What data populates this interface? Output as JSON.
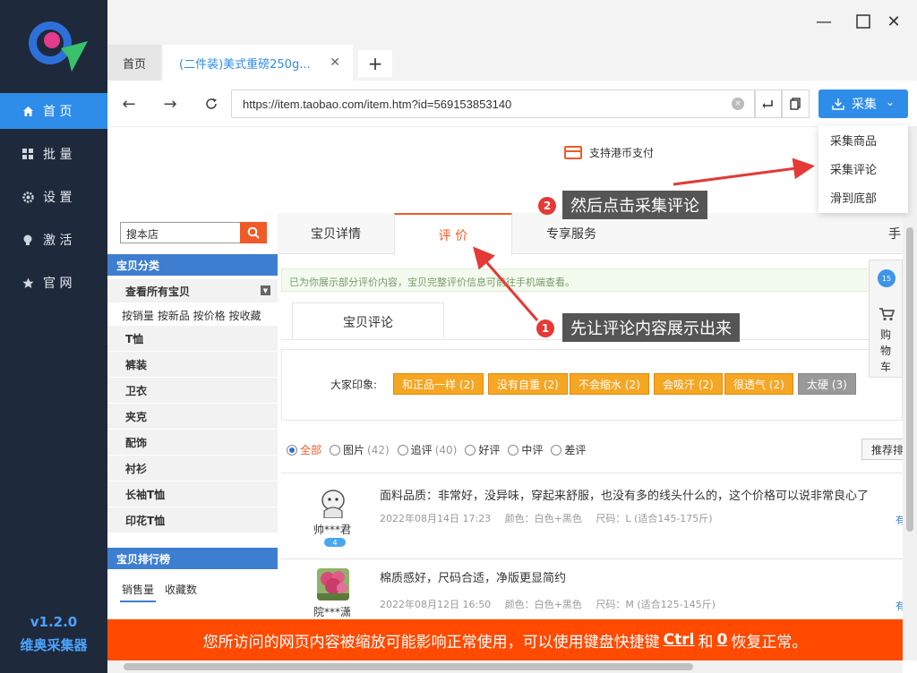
{
  "sidebar": {
    "items": [
      {
        "label": "首 页",
        "icon": "home-icon",
        "active": true
      },
      {
        "label": "批 量",
        "icon": "grid-icon"
      },
      {
        "label": "设 置",
        "icon": "gear-icon"
      },
      {
        "label": "激 活",
        "icon": "bulb-icon"
      },
      {
        "label": "官 网",
        "icon": "star-icon"
      }
    ],
    "version": "v1.2.0",
    "app_name": "维奥采集器"
  },
  "window": {
    "minimize": "—",
    "maximize": "☐",
    "close": "✕"
  },
  "tabs": {
    "home": "首页",
    "active_title": "(二件装)美式重磅250g...",
    "close": "✕",
    "add": "+"
  },
  "addressbar": {
    "back": "←",
    "forward": "→",
    "reload": "C",
    "url": "https://item.taobao.com/item.htm?id=569153853140",
    "clear": "×",
    "collect_label": "采集",
    "collect_arrow": "⌄"
  },
  "dropdown": {
    "items": [
      "采集商品",
      "采集评论",
      "滑到底部"
    ]
  },
  "page": {
    "pay_text": "支持港币支付",
    "shop_search_placeholder": "搜本店",
    "category_header": "宝贝分类",
    "all_items": "查看所有宝贝",
    "sort_links": "按销量 按新品 按价格 按收藏",
    "categories": [
      "T恤",
      "裤装",
      "卫衣",
      "夹克",
      "配饰",
      "衬衫",
      "长袖T恤",
      "印花T恤"
    ],
    "rank_header": "宝贝排行榜",
    "rank_tabs": [
      "销售量",
      "收藏数"
    ],
    "detail_tabs": [
      "宝贝详情",
      "评 价",
      "专享服务",
      "手"
    ],
    "notice": "已为你展示部分评价内容，宝贝完整评价信息可前往手机端查看。",
    "review_subtab": "宝贝评论",
    "impression_label": "大家印象:",
    "tags": [
      "和正品一样 (2)",
      "没有自重 (2)",
      "不会缩水 (2)",
      "会吸汗 (2)",
      "很透气 (2)",
      "太硬 (3)"
    ],
    "filters": [
      {
        "label": "全部",
        "count": "",
        "on": true
      },
      {
        "label": "图片",
        "count": "(42)"
      },
      {
        "label": "追评",
        "count": "(40)"
      },
      {
        "label": "好评",
        "count": ""
      },
      {
        "label": "中评",
        "count": ""
      },
      {
        "label": "差评",
        "count": ""
      }
    ],
    "sort_button": "推荐排",
    "reviews": [
      {
        "user": "帅***君",
        "text": "面料品质：非常好，没异味，穿起来舒服，也没有多的线头什么的，这个价格可以说非常良心了",
        "date": "2022年08月14日 17:23",
        "color": "颜色：白色+黑色",
        "size": "尺码：L (适合145-175斤)",
        "fav": "有",
        "badge": "4"
      },
      {
        "user": "院***潇",
        "text": "棉质感好，尺码合适，净版更显简约",
        "date": "2022年08月12日 16:50",
        "color": "颜色：白色+黑色",
        "size": "尺码：M (适合125-145斤)",
        "fav": "有"
      }
    ],
    "floatbar": {
      "top_count": "15",
      "cart_label": "购物车"
    }
  },
  "callouts": {
    "step1_num": "1",
    "step1": "先让评论内容展示出来",
    "step2_num": "2",
    "step2": "然后点击采集评论"
  },
  "banner": {
    "text_before": "您所访问的网页内容被缩放可能影响正常使用，可以使用键盘快捷键",
    "key1": "Ctrl",
    "and": "和",
    "key2": "0",
    "text_after": "恢复正常。"
  },
  "colors": {
    "sidebar_bg": "#1e2a3c",
    "accent_blue": "#2e8de8",
    "taobao_orange": "#f05a28",
    "tag_orange": "#f5a623",
    "banner": "#ff4a00",
    "arrow_red": "#e53935"
  }
}
